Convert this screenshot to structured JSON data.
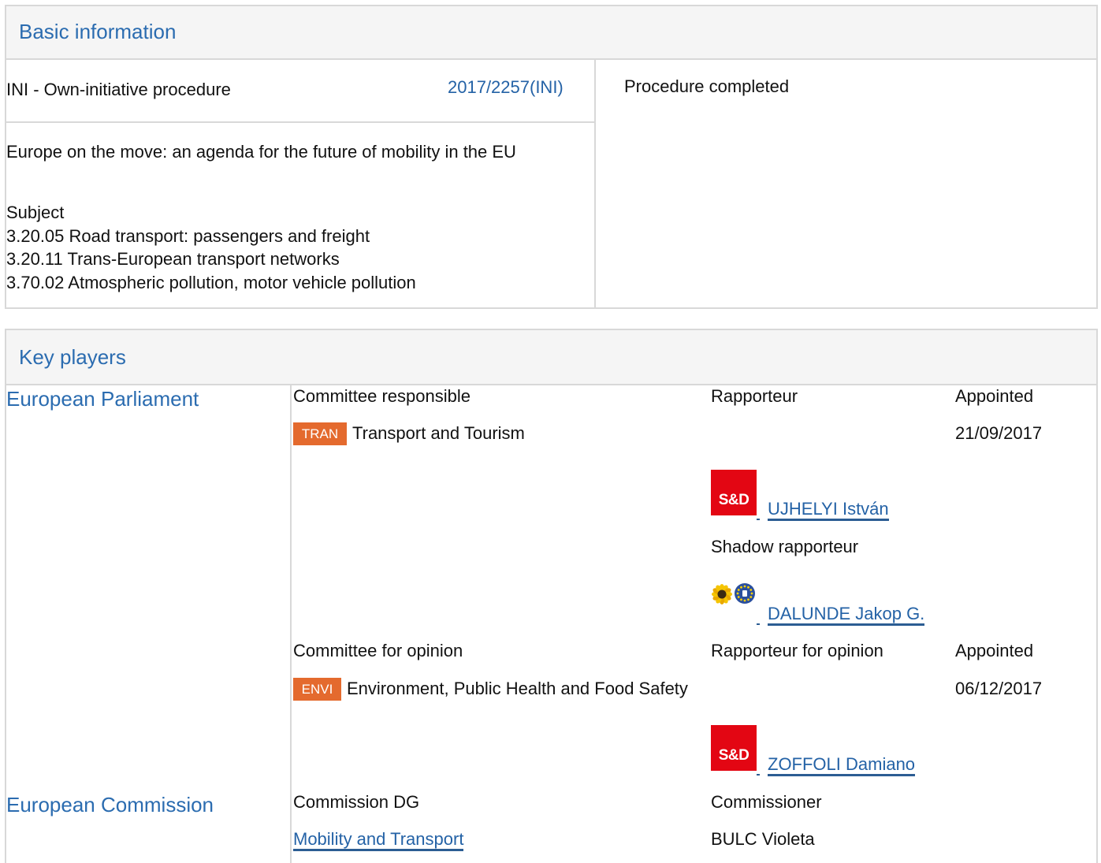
{
  "basic_information": {
    "title": "Basic information",
    "procedure_type": "INI - Own-initiative procedure",
    "reference": "2017/2257(INI)",
    "status": "Procedure completed",
    "procedure_title": "Europe on the move: an agenda for the future of mobility in the EU",
    "subject_label": "Subject",
    "subjects": [
      "3.20.05 Road transport: passengers and freight",
      "3.20.11 Trans-European transport networks",
      "3.70.02 Atmospheric pollution, motor vehicle pollution"
    ]
  },
  "key_players": {
    "title": "Key players",
    "parliament": {
      "label": "European Parliament",
      "committee_responsible": {
        "header_committee": "Committee responsible",
        "header_rapporteur": "Rapporteur",
        "header_appointed": "Appointed",
        "committee_code": "TRAN",
        "committee_name": "Transport and Tourism",
        "appointed": "21/09/2017",
        "rapporteur": {
          "group_logo": "S&D",
          "name": "UJHELYI István"
        },
        "shadow_label": "Shadow rapporteur",
        "shadow_rapporteur": {
          "group_logo_icon": "greens-efa-logo",
          "name": "DALUNDE Jakop G."
        }
      },
      "committee_opinion": {
        "header_committee": "Committee for opinion",
        "header_rapporteur": "Rapporteur for opinion",
        "header_appointed": "Appointed",
        "committee_code": "ENVI",
        "committee_name": "Environment, Public Health and Food Safety",
        "appointed": "06/12/2017",
        "rapporteur": {
          "group_logo": "S&D",
          "name": "ZOFFOLI Damiano"
        }
      }
    },
    "commission": {
      "label": "European Commission",
      "header_dg": "Commission DG",
      "header_commissioner": "Commissioner",
      "dg": "Mobility and Transport",
      "commissioner": "BULC Violeta"
    }
  },
  "colors": {
    "heading": "#2b6cb0",
    "link": "#2462a6",
    "link_underline": "#2c5d93",
    "committee_badge": "#e46a2e",
    "sd_logo": "#e30613",
    "border": "#d8d8d8",
    "panel_header_bg": "#f5f5f5"
  }
}
